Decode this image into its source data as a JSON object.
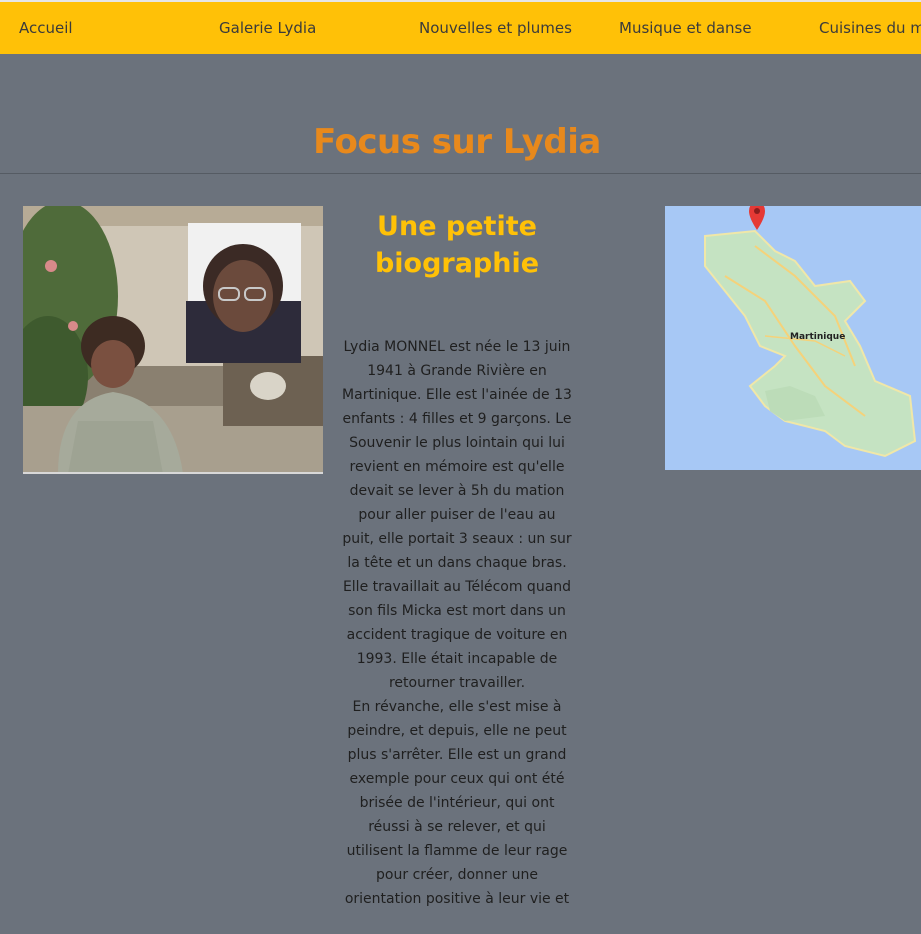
{
  "nav": {
    "items": [
      "Accueil",
      "Galerie Lydia",
      "Nouvelles et plumes",
      "Musique et danse",
      "Cuisines du mo"
    ]
  },
  "page": {
    "title": "Focus sur Lydia"
  },
  "bio": {
    "title": "Une petite biographie",
    "paragraph1": "Lydia MONNEL est née le 13 juin 1941 à Grande Rivière en Martinique. Elle est l'ainée de 13 enfants : 4 filles et 9 garçons. Le Souvenir le plus lointain qui lui revient en mémoire est qu'elle devait se lever à 5h du mation pour aller puiser de l'eau au puit, elle portait 3 seaux : un sur la tête et un dans chaque bras. Elle travaillait au Télécom quand son fils Micka est mort dans un accident tragique de voiture en 1993. Elle était incapable de retourner travailler.",
    "paragraph2": "En révanche, elle s'est mise à peindre, et depuis, elle ne peut plus s'arrêter. Elle est un grand exemple pour ceux qui ont été brisée de l'intérieur, qui ont réussi à se relever, et qui utilisent la flamme de leur rage pour créer, donner une orientation positive à leur vie et"
  },
  "map": {
    "label": "Martinique"
  },
  "colors": {
    "nav_bg": "#ffc107",
    "page_bg": "#6b727c",
    "title": "#e8891c",
    "subtitle": "#ffc107"
  }
}
